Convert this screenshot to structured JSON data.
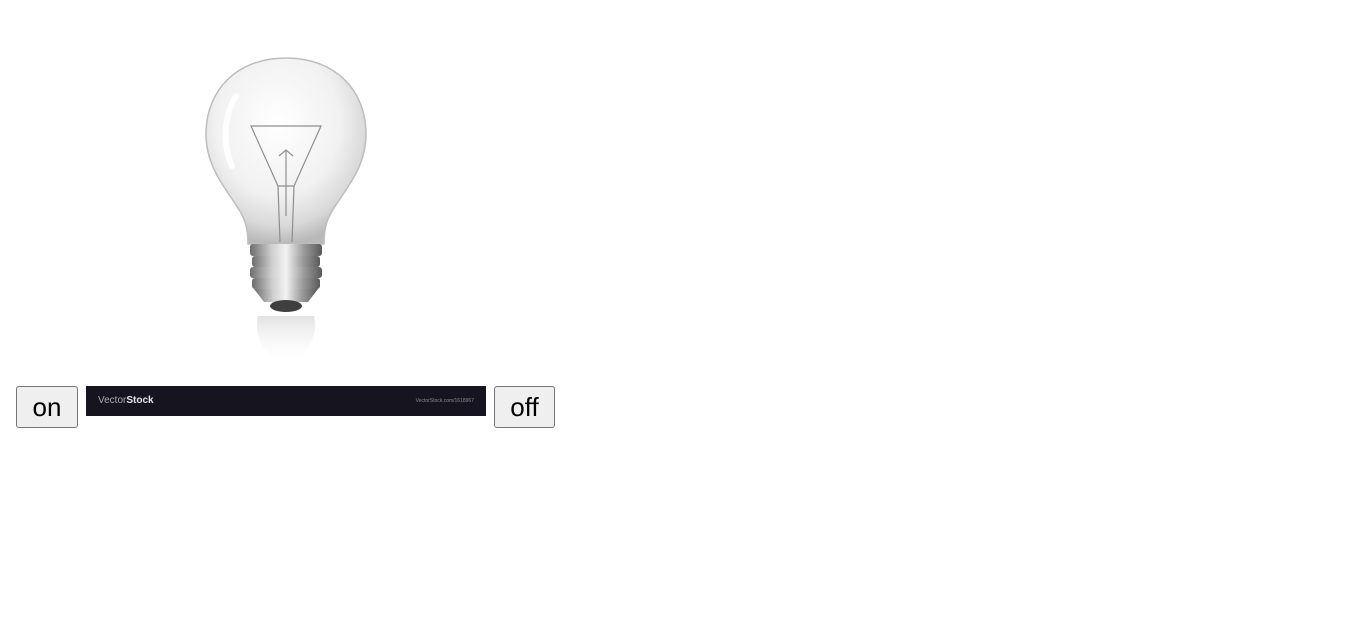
{
  "controls": {
    "on_label": "on",
    "off_label": "off"
  },
  "bulb_image": {
    "icon": "lightbulb-icon",
    "state": "off",
    "watermark": {
      "brand_prefix": "Vector",
      "brand_suffix": "Stock",
      "url": "VectorStock.com/1618967"
    }
  }
}
